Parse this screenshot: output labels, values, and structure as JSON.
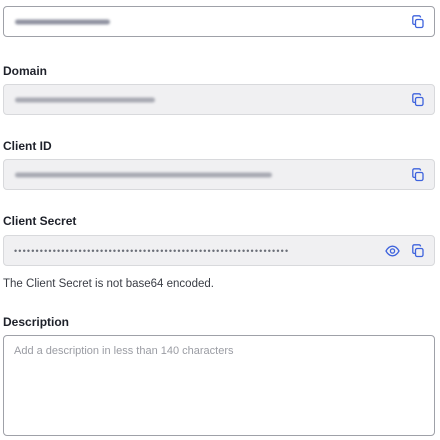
{
  "name_field": {
    "value_hint": "redacted-name"
  },
  "domain": {
    "label": "Domain"
  },
  "client_id": {
    "label": "Client ID"
  },
  "client_secret": {
    "label": "Client Secret",
    "masked_value": "••••••••••••••••••••••••••••••••••••••••••••••••••••••••••••••••",
    "helper": "The Client Secret is not base64 encoded."
  },
  "description": {
    "label": "Description",
    "placeholder": "Add a description in less than 140 characters"
  },
  "icons": {
    "copy": "copy-icon",
    "eye": "eye-icon"
  },
  "colors": {
    "accent": "#3e63dd",
    "readonly_bg": "#f0f0f2",
    "border": "#c9cace"
  }
}
